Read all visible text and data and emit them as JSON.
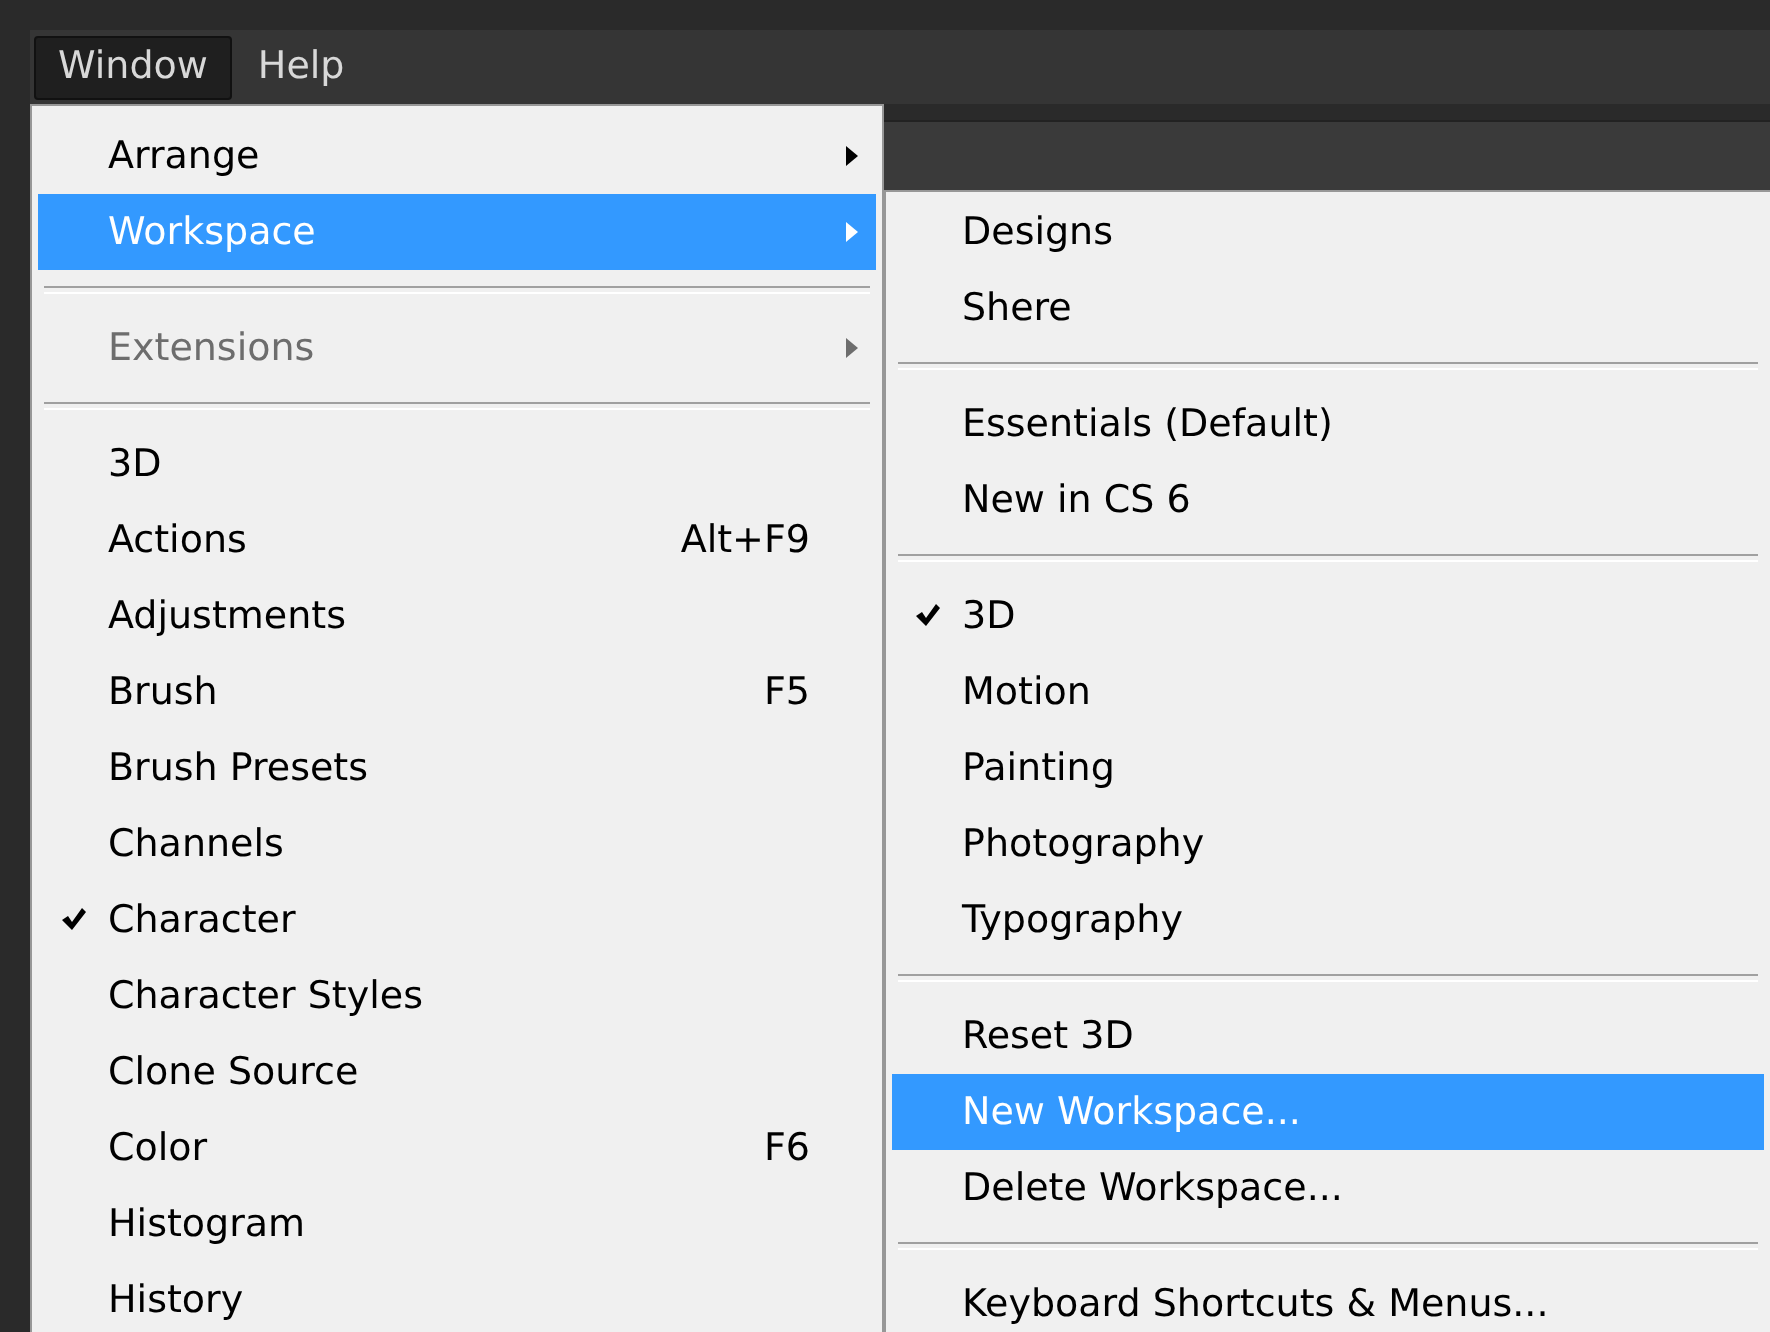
{
  "menubar": [
    {
      "label": "Window",
      "selected": true
    },
    {
      "label": "Help",
      "selected": false
    }
  ],
  "window_menu": [
    {
      "kind": "item",
      "label": "Arrange",
      "selected": false,
      "checked": false,
      "disabled": false,
      "submenu": true
    },
    {
      "kind": "item",
      "label": "Workspace",
      "selected": true,
      "checked": false,
      "disabled": false,
      "submenu": true
    },
    {
      "kind": "separator"
    },
    {
      "kind": "item",
      "label": "Extensions",
      "selected": false,
      "checked": false,
      "disabled": true,
      "submenu": true
    },
    {
      "kind": "separator"
    },
    {
      "kind": "item",
      "label": "3D",
      "selected": false,
      "checked": false,
      "disabled": false,
      "submenu": false
    },
    {
      "kind": "item",
      "label": "Actions",
      "shortcut": "Alt+F9",
      "selected": false,
      "checked": false,
      "disabled": false,
      "submenu": false
    },
    {
      "kind": "item",
      "label": "Adjustments",
      "selected": false,
      "checked": false,
      "disabled": false,
      "submenu": false
    },
    {
      "kind": "item",
      "label": "Brush",
      "shortcut": "F5",
      "selected": false,
      "checked": false,
      "disabled": false,
      "submenu": false
    },
    {
      "kind": "item",
      "label": "Brush Presets",
      "selected": false,
      "checked": false,
      "disabled": false,
      "submenu": false
    },
    {
      "kind": "item",
      "label": "Channels",
      "selected": false,
      "checked": false,
      "disabled": false,
      "submenu": false
    },
    {
      "kind": "item",
      "label": "Character",
      "selected": false,
      "checked": true,
      "disabled": false,
      "submenu": false
    },
    {
      "kind": "item",
      "label": "Character Styles",
      "selected": false,
      "checked": false,
      "disabled": false,
      "submenu": false
    },
    {
      "kind": "item",
      "label": "Clone Source",
      "selected": false,
      "checked": false,
      "disabled": false,
      "submenu": false
    },
    {
      "kind": "item",
      "label": "Color",
      "shortcut": "F6",
      "selected": false,
      "checked": false,
      "disabled": false,
      "submenu": false
    },
    {
      "kind": "item",
      "label": "Histogram",
      "selected": false,
      "checked": false,
      "disabled": false,
      "submenu": false
    },
    {
      "kind": "item",
      "label": "History",
      "selected": false,
      "checked": false,
      "disabled": false,
      "submenu": false
    }
  ],
  "workspace_submenu": [
    {
      "kind": "item",
      "label": "Designs",
      "selected": false,
      "checked": false
    },
    {
      "kind": "item",
      "label": "Shere",
      "selected": false,
      "checked": false
    },
    {
      "kind": "separator"
    },
    {
      "kind": "item",
      "label": "Essentials (Default)",
      "selected": false,
      "checked": false
    },
    {
      "kind": "item",
      "label": "New in CS 6",
      "selected": false,
      "checked": false
    },
    {
      "kind": "separator"
    },
    {
      "kind": "item",
      "label": "3D",
      "selected": false,
      "checked": true
    },
    {
      "kind": "item",
      "label": "Motion",
      "selected": false,
      "checked": false
    },
    {
      "kind": "item",
      "label": "Painting",
      "selected": false,
      "checked": false
    },
    {
      "kind": "item",
      "label": "Photography",
      "selected": false,
      "checked": false
    },
    {
      "kind": "item",
      "label": "Typography",
      "selected": false,
      "checked": false
    },
    {
      "kind": "separator"
    },
    {
      "kind": "item",
      "label": "Reset 3D",
      "selected": false,
      "checked": false
    },
    {
      "kind": "item",
      "label": "New Workspace...",
      "selected": true,
      "checked": false
    },
    {
      "kind": "item",
      "label": "Delete Workspace...",
      "selected": false,
      "checked": false
    },
    {
      "kind": "separator"
    },
    {
      "kind": "item",
      "label": "Keyboard Shortcuts & Menus...",
      "selected": false,
      "checked": false
    }
  ]
}
